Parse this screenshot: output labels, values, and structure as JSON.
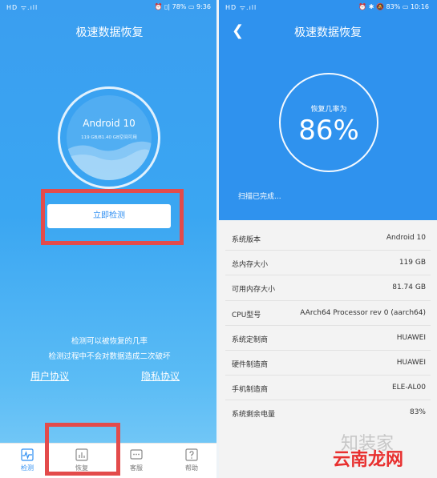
{
  "left": {
    "status_left": "HD ᯤ.ıll",
    "status_right": "⏰ ▯| 78% ▭ 9:36",
    "title": "极速数据恢复",
    "ring_title": "Android 10",
    "ring_subtitle": "119 GB/81.40 GB空间可用",
    "detect_button": "立即检测",
    "info_line1": "检测可以被恢复的几率",
    "info_line2": "检测过程中不会对数据造成二次破坏",
    "link_user": "用户协议",
    "link_privacy": "隐私协议",
    "nav": [
      {
        "label": "检测"
      },
      {
        "label": "恢复"
      },
      {
        "label": "客服"
      },
      {
        "label": "帮助"
      }
    ]
  },
  "right": {
    "status_left": "HD ᯤ.ıll",
    "status_right": "⏰ ✱ 🔕 83% ▭ 10:16",
    "title": "极速数据恢复",
    "ring_label": "恢复几率为",
    "ring_percent": "86%",
    "scan_status": "扫描已完成...",
    "rows": [
      {
        "label": "系统版本",
        "value": "Android 10"
      },
      {
        "label": "总内存大小",
        "value": "119 GB"
      },
      {
        "label": "可用内存大小",
        "value": "81.74 GB"
      },
      {
        "label": "CPU型号",
        "value": "AArch64 Processor rev 0 (aarch64)"
      },
      {
        "label": "系统定制商",
        "value": "HUAWEI"
      },
      {
        "label": "硬件制造商",
        "value": "HUAWEI"
      },
      {
        "label": "手机制造商",
        "value": "ELE-AL00"
      },
      {
        "label": "系统剩余电量",
        "value": "83%"
      }
    ]
  },
  "watermark": {
    "line1": "知装家",
    "line2": "云南龙网"
  },
  "colors": {
    "primary_blue": "#2f92ee",
    "highlight_red": "#e34b4b",
    "detect_text": "#2f8ff2"
  }
}
